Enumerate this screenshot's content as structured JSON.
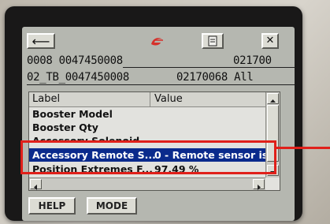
{
  "toolbar": {
    "back_icon_glyph": "⟵",
    "doc_icon": "document-icon",
    "close_icon_glyph": "✕",
    "logo_icon": "emerson-logo-icon",
    "logo_color": "#d6312b"
  },
  "header": {
    "line1_left": "0008 0047450008",
    "line1_right": "021700",
    "line2_left": "02_TB_0047450008",
    "line2_right": "02170068 All"
  },
  "grid": {
    "columns": [
      "Label",
      "Value"
    ],
    "rows": [
      {
        "label": "Booster Model",
        "value": ""
      },
      {
        "label": "Booster Qty",
        "value": ""
      },
      {
        "label": "Accessory Solenoid",
        "value": ""
      },
      {
        "label": "Accessory Remote S...",
        "value": "0 - Remote sensor is..."
      },
      {
        "label": "Position Extremes F...",
        "value": "97.49 %"
      }
    ],
    "selected_row": 3,
    "selection_color": "#0a2a8c"
  },
  "buttons": {
    "help": "HELP",
    "mode": "MODE"
  },
  "annotation": {
    "highlight_color": "#e0201a"
  }
}
